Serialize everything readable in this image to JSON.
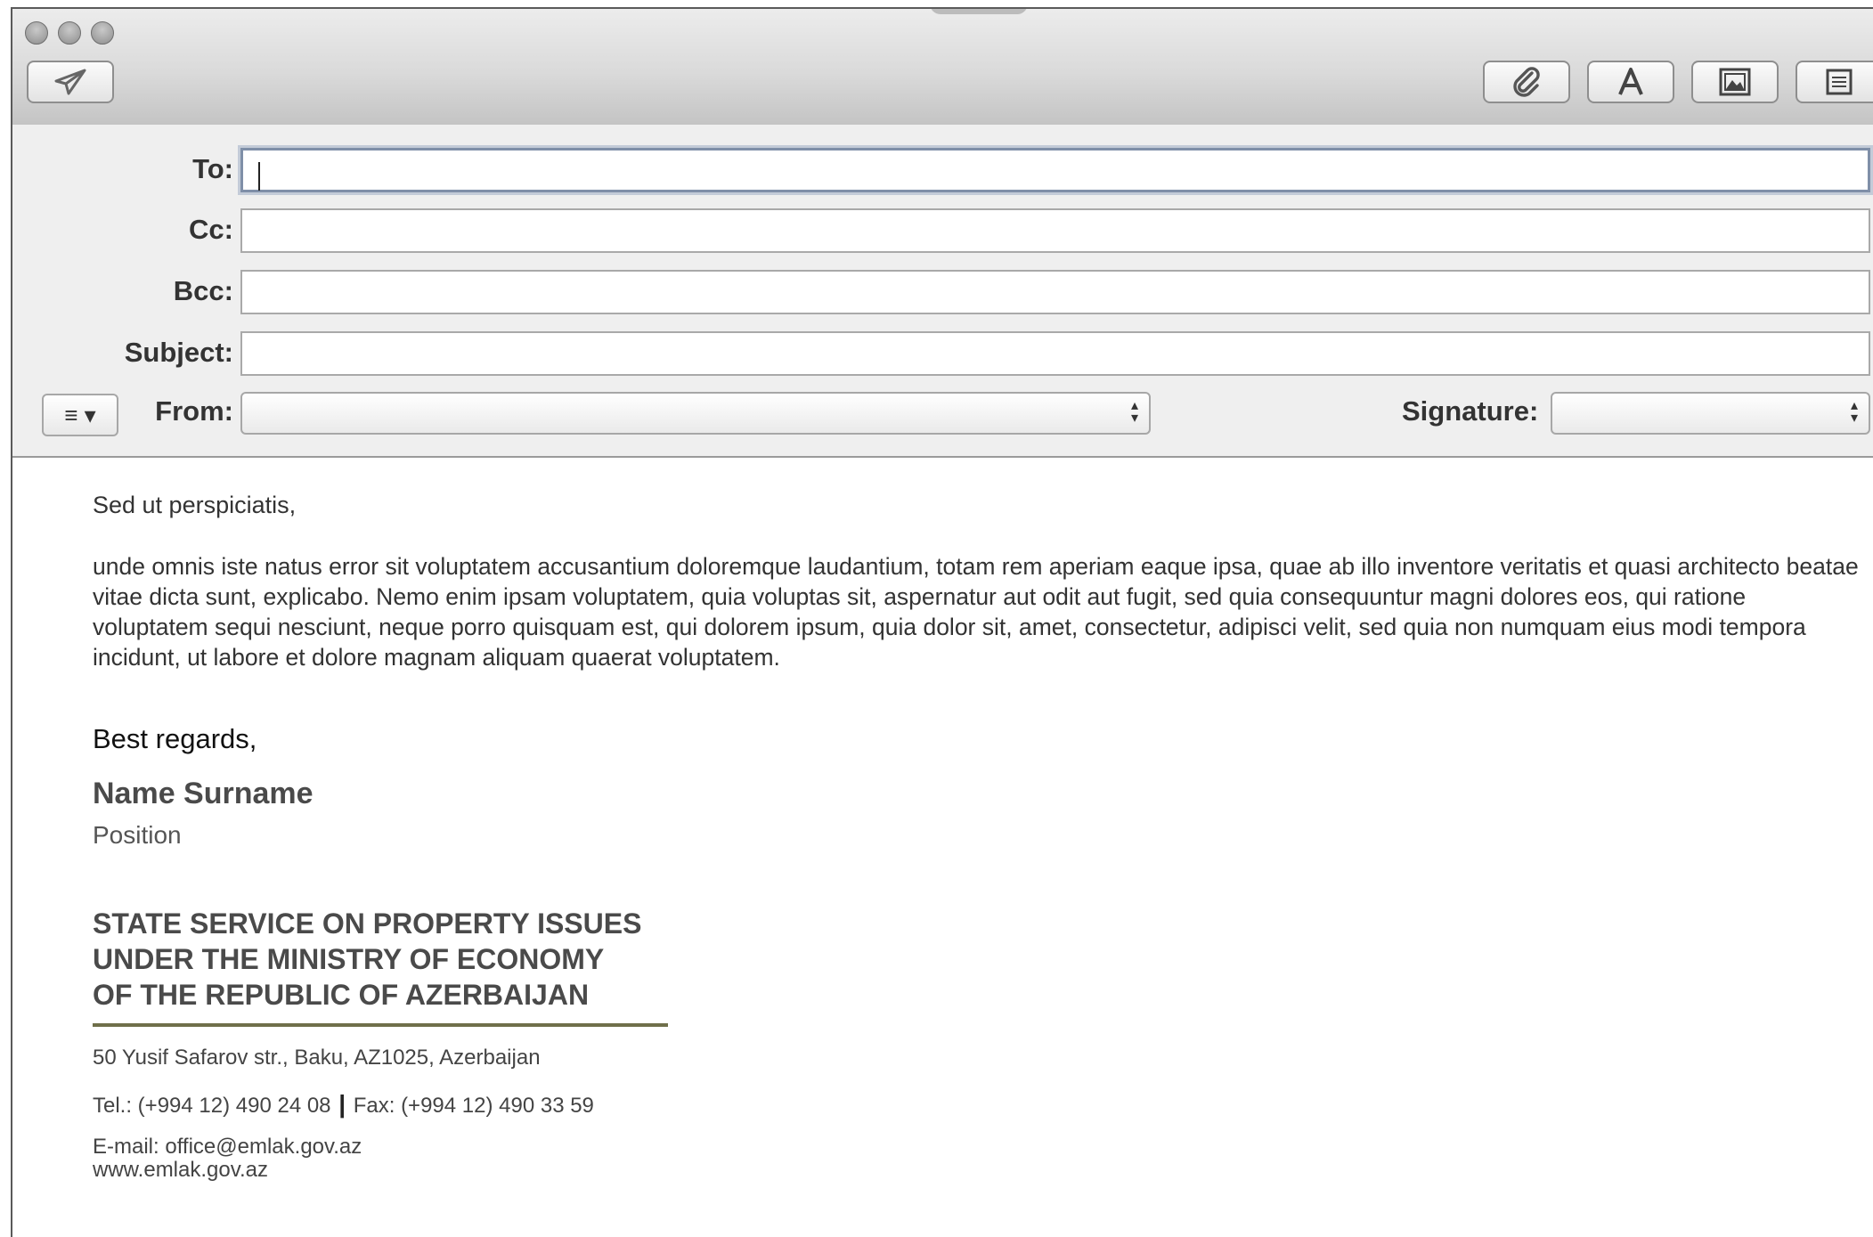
{
  "toolbar": {
    "window_buttons": [
      "close",
      "minimize",
      "zoom"
    ],
    "send_icon": "paper-plane-icon",
    "right_icons": [
      "paperclip-icon",
      "font-icon",
      "photo-browser-icon",
      "stationery-icon"
    ]
  },
  "headers": {
    "to_label": "To:",
    "cc_label": "Cc:",
    "bcc_label": "Bcc:",
    "subject_label": "Subject:",
    "from_label": "From:",
    "signature_label": "Signature:",
    "to_value": "",
    "cc_value": "",
    "bcc_value": "",
    "subject_value": "",
    "from_value": "",
    "signature_value": "",
    "menu_icon": "≡ ▾"
  },
  "message": {
    "greeting": "Sed ut perspiciatis,",
    "paragraph": "unde omnis iste natus error sit voluptatem accusantium doloremque laudantium, totam rem aperiam eaque ipsa, quae ab illo inventore veritatis et quasi architecto beatae vitae dicta sunt, explicabo. Nemo enim ipsam voluptatem, quia voluptas sit, aspernatur aut odit aut fugit, sed quia consequuntur magni dolores eos, qui ratione voluptatem sequi nesciunt, neque porro quisquam est, qui dolorem ipsum, quia dolor sit, amet, consectetur, adipisci velit, sed quia non numquam eius modi tempora incidunt, ut labore et dolore magnam aliquam quaerat voluptatem.",
    "closing": "Best regards,"
  },
  "signature": {
    "name": "Name Surname",
    "position": "Position",
    "org_line1": "STATE SERVICE ON PROPERTY ISSUES",
    "org_line2": "UNDER THE MINISTRY OF ECONOMY",
    "org_line3": "OF THE REPUBLIC OF AZERBAIJAN",
    "address": "50 Yusif Safarov str., Baku, AZ1025, Azerbaijan",
    "tel": "Tel.: (+994 12) 490 24 08",
    "separator": "|",
    "fax": "Fax: (+994 12) 490 33 59",
    "email": "E-mail: office@emlak.gov.az",
    "website": "www.emlak.gov.az",
    "rule_color": "#6f6f4a"
  }
}
